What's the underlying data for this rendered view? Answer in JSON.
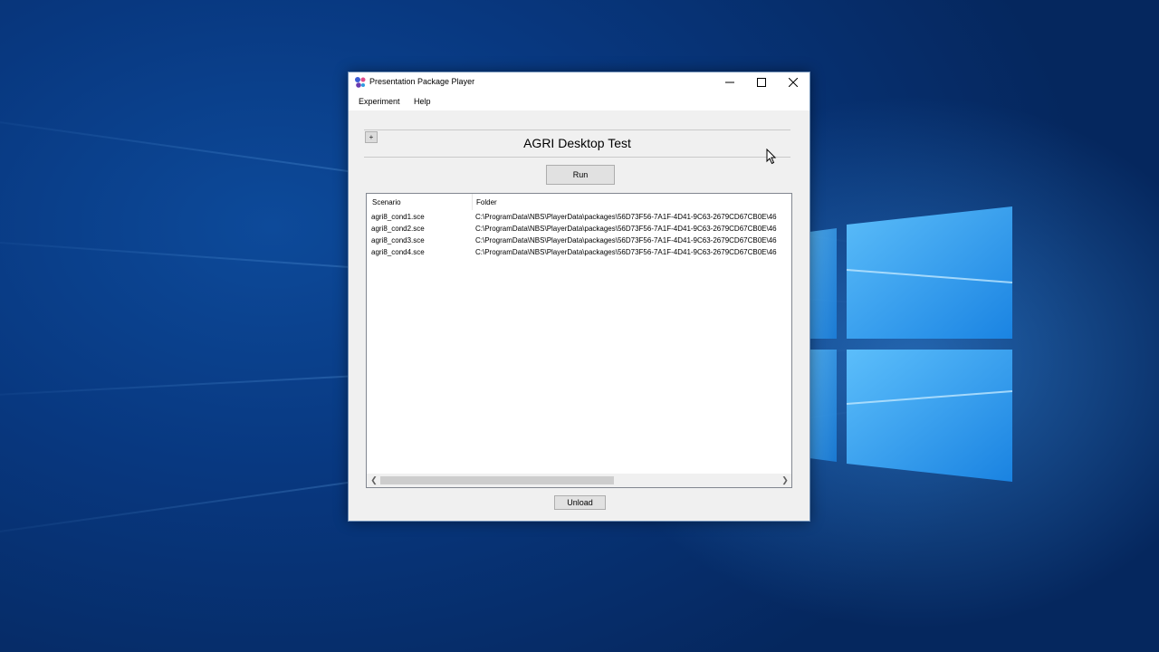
{
  "window": {
    "title": "Presentation Package Player",
    "minimize_icon": "minimize-icon",
    "maximize_icon": "maximize-icon",
    "close_icon": "close-icon"
  },
  "menu": {
    "items": [
      "Experiment",
      "Help"
    ]
  },
  "header": {
    "expand_label": "+",
    "title": "AGRI Desktop Test"
  },
  "actions": {
    "run_label": "Run",
    "unload_label": "Unload"
  },
  "scenario_list": {
    "columns": [
      "Scenario",
      "Folder"
    ],
    "rows": [
      {
        "scenario": "agri8_cond1.sce",
        "folder": "C:\\ProgramData\\NBS\\PlayerData\\packages\\56D73F56-7A1F-4D41-9C63-2679CD67CB0E\\46"
      },
      {
        "scenario": "agri8_cond2.sce",
        "folder": "C:\\ProgramData\\NBS\\PlayerData\\packages\\56D73F56-7A1F-4D41-9C63-2679CD67CB0E\\46"
      },
      {
        "scenario": "agri8_cond3.sce",
        "folder": "C:\\ProgramData\\NBS\\PlayerData\\packages\\56D73F56-7A1F-4D41-9C63-2679CD67CB0E\\46"
      },
      {
        "scenario": "agri8_cond4.sce",
        "folder": "C:\\ProgramData\\NBS\\PlayerData\\packages\\56D73F56-7A1F-4D41-9C63-2679CD67CB0E\\46"
      }
    ]
  },
  "colors": {
    "desktop": "#083880",
    "window_bg": "#f0f0f0",
    "button_bg": "#e1e1e1"
  }
}
